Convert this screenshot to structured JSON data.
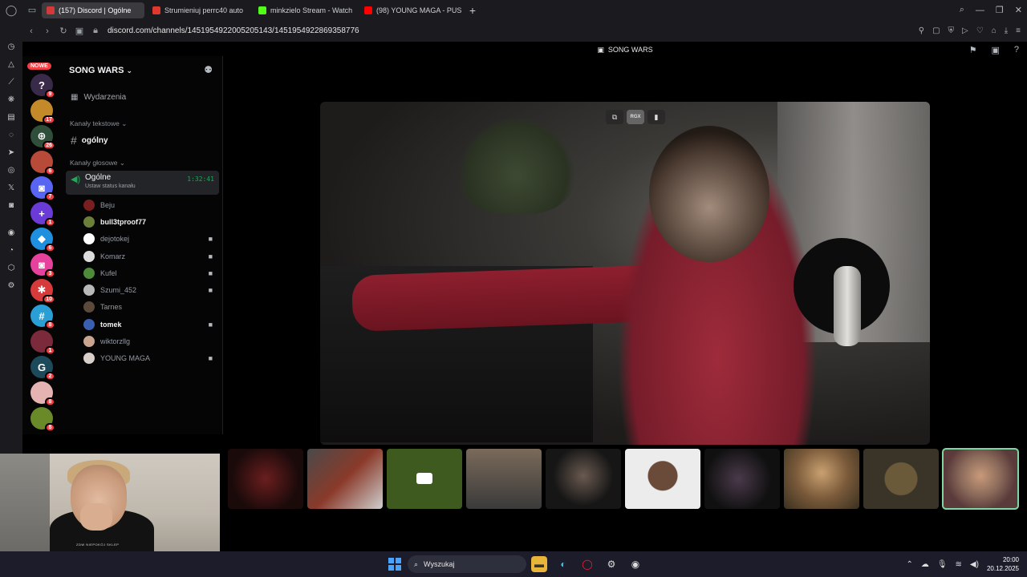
{
  "browser": {
    "tabs": [
      {
        "label": "(157) Discord | Ogólne",
        "color": "#d23a3a",
        "active": true
      },
      {
        "label": "Strumieniuj perrc40 auto",
        "color": "#e0382b",
        "active": false
      },
      {
        "label": "minkzielo Stream - Watch",
        "color": "#53fc18",
        "active": false
      },
      {
        "label": "(98) YOUNG MAGA - PUS",
        "color": "#ff0000",
        "active": false
      }
    ],
    "new_tab": "+",
    "url": "discord.com/channels/1451954922005205143/1451954922869358776"
  },
  "discord": {
    "nowe_badge": "NOWE",
    "server_name": "SONG WARS",
    "events_label": "Wydarzenia",
    "text_category": "Kanały tekstowe",
    "text_channel": "ogólny",
    "voice_category": "Kanały głosowe",
    "voice_channel": {
      "name": "Ogólne",
      "status": "Ustaw status kanału",
      "timer": "1:32:41"
    },
    "members": [
      {
        "name": "Beju",
        "bold": false,
        "camera": false,
        "color": "#7a1f1f"
      },
      {
        "name": "bull3tproof77",
        "bold": true,
        "camera": false,
        "color": "#6b7f3a"
      },
      {
        "name": "dejotokej",
        "bold": false,
        "camera": true,
        "color": "#ffffff"
      },
      {
        "name": "Komarz",
        "bold": false,
        "camera": true,
        "color": "#dcdcdc"
      },
      {
        "name": "Kufel",
        "bold": false,
        "camera": true,
        "color": "#4f8a3a"
      },
      {
        "name": "Szumi_452",
        "bold": false,
        "camera": true,
        "color": "#b8b8b8"
      },
      {
        "name": "Tarnes",
        "bold": false,
        "camera": false,
        "color": "#5b4a3a"
      },
      {
        "name": "tomek",
        "bold": true,
        "camera": true,
        "color": "#3b5fb0"
      },
      {
        "name": "wiktorzllg",
        "bold": false,
        "camera": false,
        "color": "#c9a58f"
      },
      {
        "name": "YOUNG MAGA",
        "bold": false,
        "camera": true,
        "color": "#d8d0c8"
      }
    ],
    "guild_badges": [
      "9",
      "17",
      "26",
      "6",
      "7",
      "1",
      "6",
      "3",
      "10",
      "8",
      "1",
      "2",
      "8",
      "8"
    ],
    "stage_title": "SONG WARS",
    "video_controls": {
      "rgx": "RGX"
    }
  },
  "taskbar": {
    "search_label": "Wyszukaj",
    "time": "20:00",
    "date": "20.12.2025"
  },
  "webcam": {
    "shirt_text": "ZDW NIEPOKÓJ SKLEP"
  }
}
